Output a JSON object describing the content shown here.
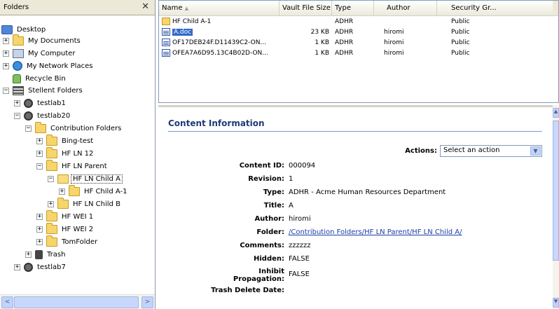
{
  "tree": {
    "title": "Folders",
    "close_glyph": "✕",
    "nodes": [
      {
        "label": "Desktop",
        "icon": "desktop-icon"
      },
      {
        "label": "My Documents",
        "icon": "folder-icon",
        "expander": "+"
      },
      {
        "label": "My Computer",
        "icon": "computer-icon",
        "expander": "+"
      },
      {
        "label": "My Network Places",
        "icon": "network-icon",
        "expander": "+"
      },
      {
        "label": "Recycle Bin",
        "icon": "recycle-bin-icon"
      },
      {
        "label": "Stellent Folders",
        "icon": "stellent-icon",
        "expander": "−"
      },
      {
        "label": "testlab1",
        "icon": "server-icon",
        "expander": "+"
      },
      {
        "label": "testlab20",
        "icon": "server-icon",
        "expander": "−"
      },
      {
        "label": "Contribution Folders",
        "icon": "folder-icon",
        "expander": "−"
      },
      {
        "label": "Bing-test",
        "icon": "folder-icon",
        "expander": "+"
      },
      {
        "label": "HF LN 12",
        "icon": "folder-icon",
        "expander": "+"
      },
      {
        "label": "HF LN Parent",
        "icon": "folder-icon",
        "expander": "−"
      },
      {
        "label": "HF LN Child A",
        "icon": "folder-open-icon",
        "expander": "−"
      },
      {
        "label": "HF Child A-1",
        "icon": "folder-icon",
        "expander": "+"
      },
      {
        "label": "HF LN Child B",
        "icon": "folder-icon",
        "expander": "+"
      },
      {
        "label": "HF WEI 1",
        "icon": "folder-icon",
        "expander": "+"
      },
      {
        "label": "HF WEI 2",
        "icon": "folder-icon",
        "expander": "+"
      },
      {
        "label": "TomFolder",
        "icon": "folder-icon",
        "expander": "+"
      },
      {
        "label": "Trash",
        "icon": "trash-icon",
        "expander": "+"
      },
      {
        "label": "testlab7",
        "icon": "server-icon",
        "expander": "+"
      }
    ],
    "scroll_left": "<",
    "scroll_right": ">"
  },
  "list": {
    "columns": [
      "Name",
      "Vault File Size",
      "Type",
      "Author",
      "Security Gr..."
    ],
    "sort_glyph": "▲",
    "rows": [
      {
        "name": "HF Child A-1",
        "size": "",
        "type": "ADHR",
        "author": "",
        "security": "Public",
        "icon": "folder-icon"
      },
      {
        "name": "A.doc",
        "size": "23 KB",
        "type": "ADHR",
        "author": "hiromi",
        "security": "Public",
        "icon": "document-icon"
      },
      {
        "name": "OF17DEB24F.D11439C2-ON...",
        "size": "1 KB",
        "type": "ADHR",
        "author": "hiromi",
        "security": "Public",
        "icon": "document-icon"
      },
      {
        "name": "OFEA7A6D95.13C4B02D-ON...",
        "size": "1 KB",
        "type": "ADHR",
        "author": "hiromi",
        "security": "Public",
        "icon": "document-icon"
      }
    ]
  },
  "info": {
    "title": "Content Information",
    "actions_label": "Actions:",
    "actions_value": "Select an action",
    "fields": [
      {
        "label": "Content ID:",
        "value": "000094"
      },
      {
        "label": "Revision:",
        "value": "1"
      },
      {
        "label": "Type:",
        "value": "ADHR - Acme Human Resources Department"
      },
      {
        "label": "Title:",
        "value": "A"
      },
      {
        "label": "Author:",
        "value": "hiromi"
      },
      {
        "label": "Folder:",
        "value": "/Contribution Folders/HF LN Parent/HF LN Child A/"
      },
      {
        "label": "Comments:",
        "value": "zzzzzz"
      },
      {
        "label": "Hidden:",
        "value": "FALSE"
      },
      {
        "label": "Inhibit",
        "label2": "Propagation:",
        "value": "FALSE"
      },
      {
        "label": "Trash Delete Date:",
        "value": ""
      }
    ]
  },
  "colors": {
    "accent": "#316ac5",
    "title": "#1f3b73",
    "link": "#1b3ea6"
  }
}
